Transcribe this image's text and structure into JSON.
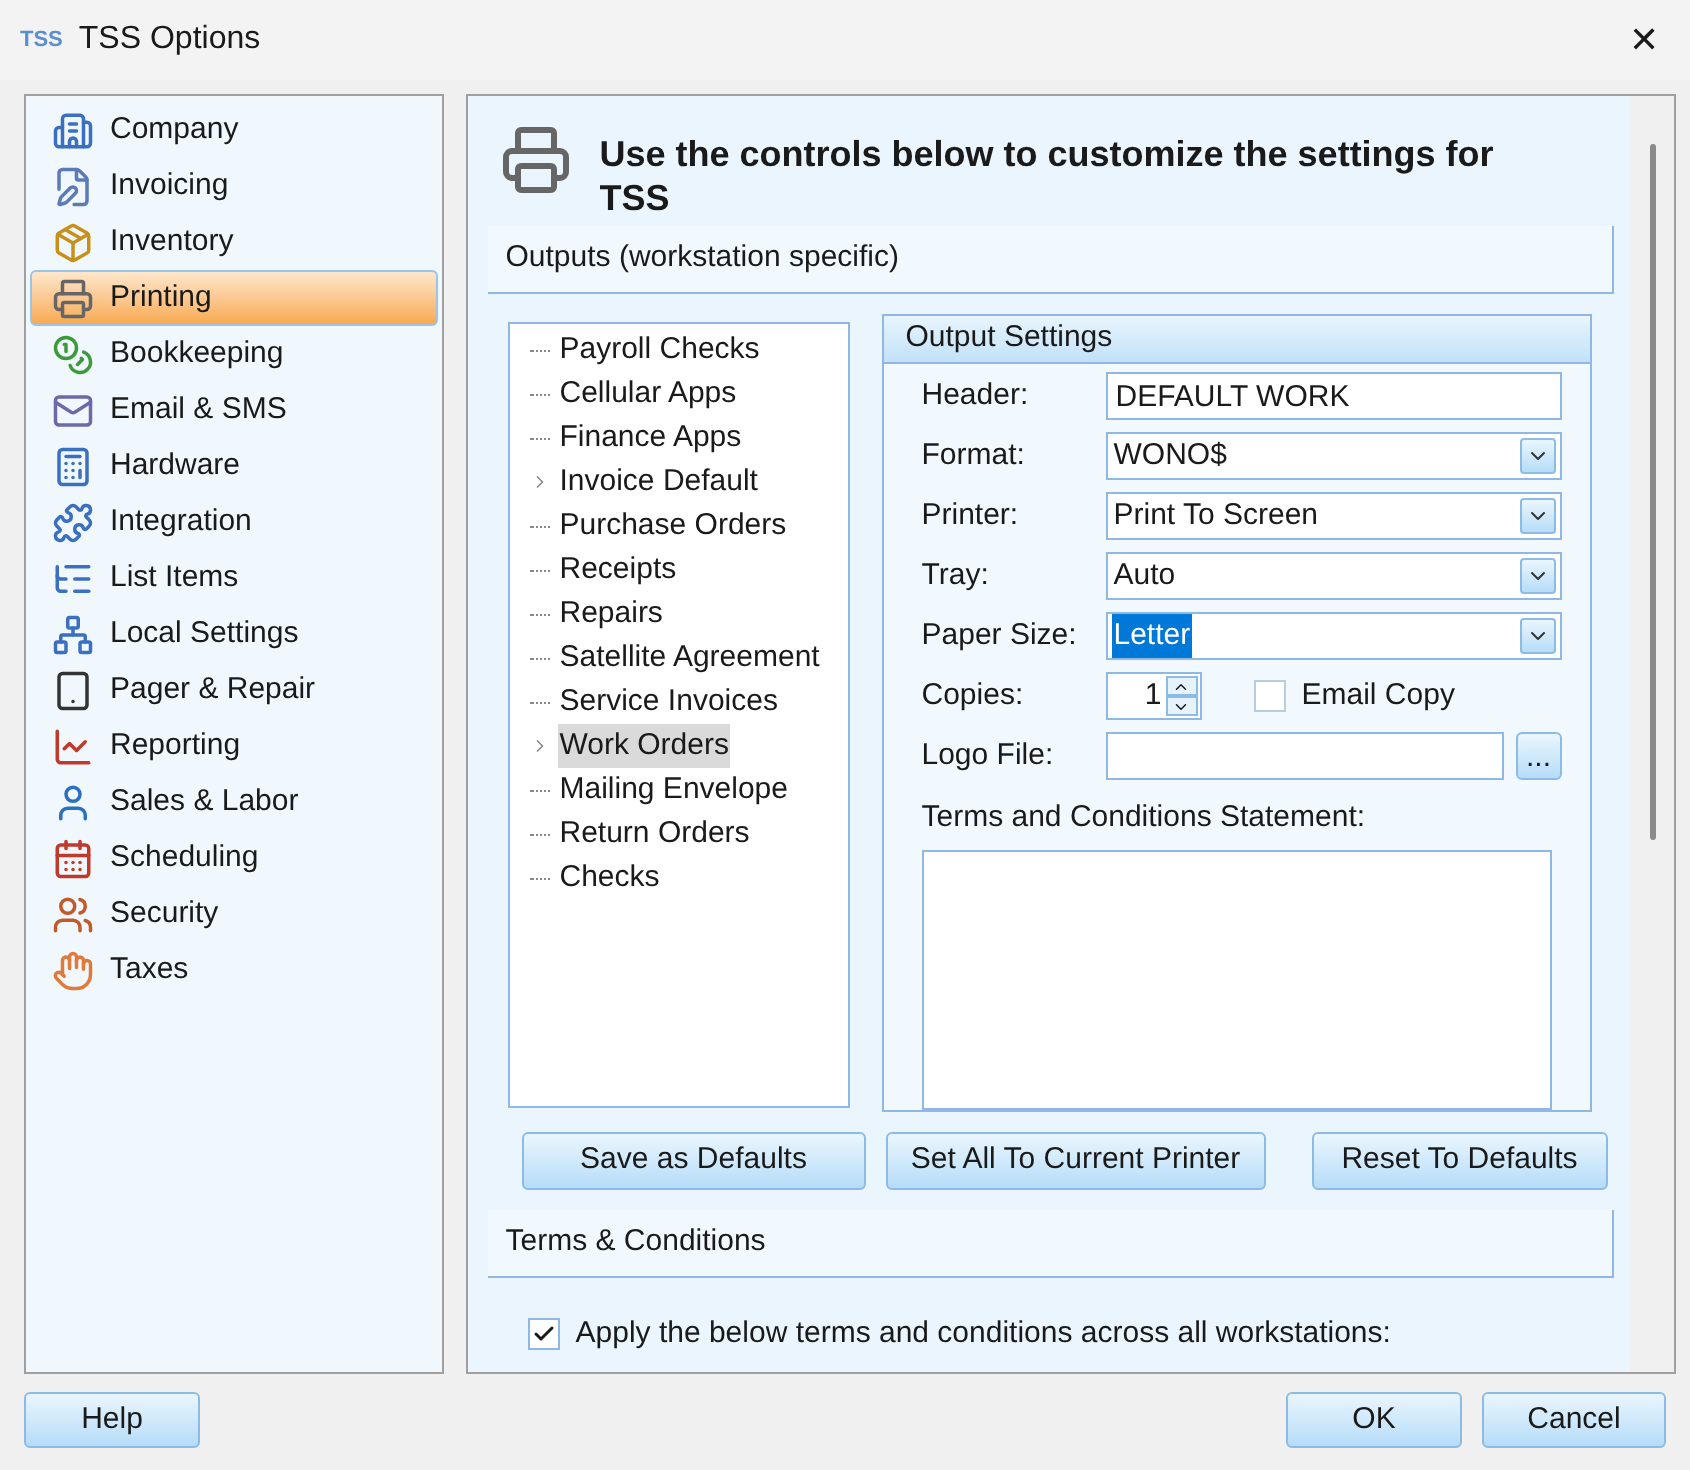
{
  "window": {
    "logo": "TSS",
    "title": "TSS Options",
    "close": "✕"
  },
  "sidebar": {
    "items": [
      {
        "label": "Company",
        "selected": false
      },
      {
        "label": "Invoicing",
        "selected": false
      },
      {
        "label": "Inventory",
        "selected": false
      },
      {
        "label": "Printing",
        "selected": true
      },
      {
        "label": "Bookkeeping",
        "selected": false
      },
      {
        "label": "Email & SMS",
        "selected": false
      },
      {
        "label": "Hardware",
        "selected": false
      },
      {
        "label": "Integration",
        "selected": false
      },
      {
        "label": "List Items",
        "selected": false
      },
      {
        "label": "Local Settings",
        "selected": false
      },
      {
        "label": "Pager & Repair",
        "selected": false
      },
      {
        "label": "Reporting",
        "selected": false
      },
      {
        "label": "Sales & Labor",
        "selected": false
      },
      {
        "label": "Scheduling",
        "selected": false
      },
      {
        "label": "Security",
        "selected": false
      },
      {
        "label": "Taxes",
        "selected": false
      }
    ]
  },
  "header": {
    "title": "Use the controls below to customize the settings for TSS"
  },
  "outputs": {
    "title": "Outputs (workstation specific)",
    "tree": [
      {
        "label": "Payroll Checks",
        "expandable": false,
        "selected": false
      },
      {
        "label": "Cellular Apps",
        "expandable": false,
        "selected": false
      },
      {
        "label": "Finance Apps",
        "expandable": false,
        "selected": false
      },
      {
        "label": "Invoice Default",
        "expandable": true,
        "selected": false
      },
      {
        "label": "Purchase Orders",
        "expandable": false,
        "selected": false
      },
      {
        "label": "Receipts",
        "expandable": false,
        "selected": false
      },
      {
        "label": "Repairs",
        "expandable": false,
        "selected": false
      },
      {
        "label": "Satellite Agreement",
        "expandable": false,
        "selected": false
      },
      {
        "label": "Service Invoices",
        "expandable": false,
        "selected": false
      },
      {
        "label": "Work Orders",
        "expandable": true,
        "selected": true
      },
      {
        "label": "Mailing Envelope",
        "expandable": false,
        "selected": false
      },
      {
        "label": "Return Orders",
        "expandable": false,
        "selected": false
      },
      {
        "label": "Checks",
        "expandable": false,
        "selected": false
      }
    ],
    "settings": {
      "title": "Output Settings",
      "fields": [
        {
          "kind": "text",
          "label": "Header:",
          "value": "DEFAULT WORK"
        },
        {
          "kind": "select",
          "label": "Format:",
          "value": "WONO$",
          "highlighted": false
        },
        {
          "kind": "select",
          "label": "Printer:",
          "value": "Print To Screen",
          "highlighted": false
        },
        {
          "kind": "select",
          "label": "Tray:",
          "value": "Auto",
          "highlighted": false
        },
        {
          "kind": "select",
          "label": "Paper Size:",
          "value": "Letter",
          "highlighted": true
        },
        {
          "kind": "spinner",
          "label": "Copies:",
          "value": "1",
          "checkbox": {
            "label": "Email Copy",
            "checked": false
          }
        },
        {
          "kind": "file",
          "label": "Logo File:",
          "browse": "..."
        }
      ],
      "terms_label": "Terms and Conditions Statement:"
    },
    "buttons": [
      "Save as Defaults",
      "Set All To Current Printer",
      "Reset To Defaults"
    ]
  },
  "terms": {
    "title": "Terms & Conditions",
    "apply": {
      "label": "Apply the below terms and conditions across all workstations:",
      "checked": true
    }
  },
  "footer": {
    "help": "Help",
    "ok": "OK",
    "cancel": "Cancel"
  }
}
